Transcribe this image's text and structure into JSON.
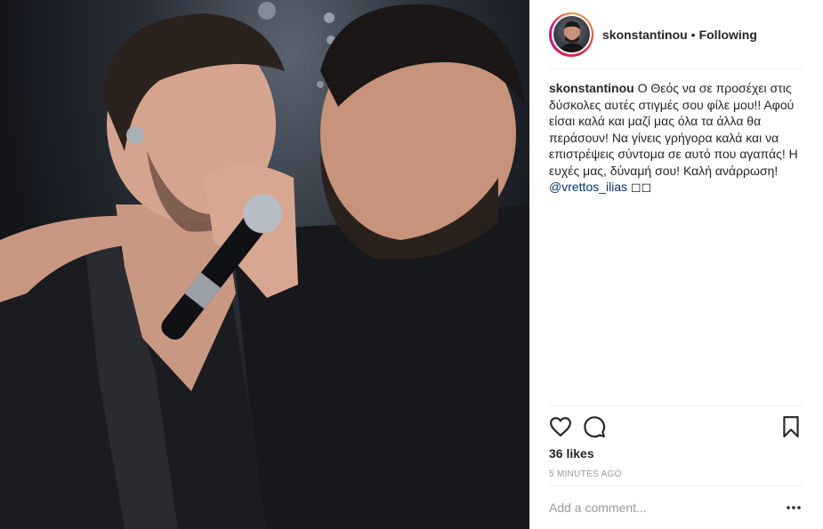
{
  "post": {
    "image_alt": "Two men singing into a microphone together",
    "header": {
      "username": "skonstantinou",
      "separator": "•",
      "follow_status": "Following"
    },
    "caption": {
      "username": "skonstantinou",
      "text": "Ο Θεός να σε προσέχει στις δύσκολες αυτές στιγμές σου φίλε μου!! Αφού είσαι καλά και μαζί μας όλα τα άλλα θα περάσουν! Να γίνεις γρήγορα καλά και να επιστρέψεις σύντομα σε αυτό που αγαπάς! Η ευχές μας, δύναμή σου! Καλή ανάρρωση!",
      "mention": "@vrettos_ilias",
      "trailing": "◻◻"
    },
    "actions": {
      "like_icon": "heart-icon",
      "comment_icon": "comment-bubble-icon",
      "save_icon": "bookmark-icon"
    },
    "likes": "36 likes",
    "timestamp": "5 MINUTES AGO",
    "comment": {
      "placeholder": "Add a comment...",
      "more_icon": "more-options-icon"
    }
  }
}
